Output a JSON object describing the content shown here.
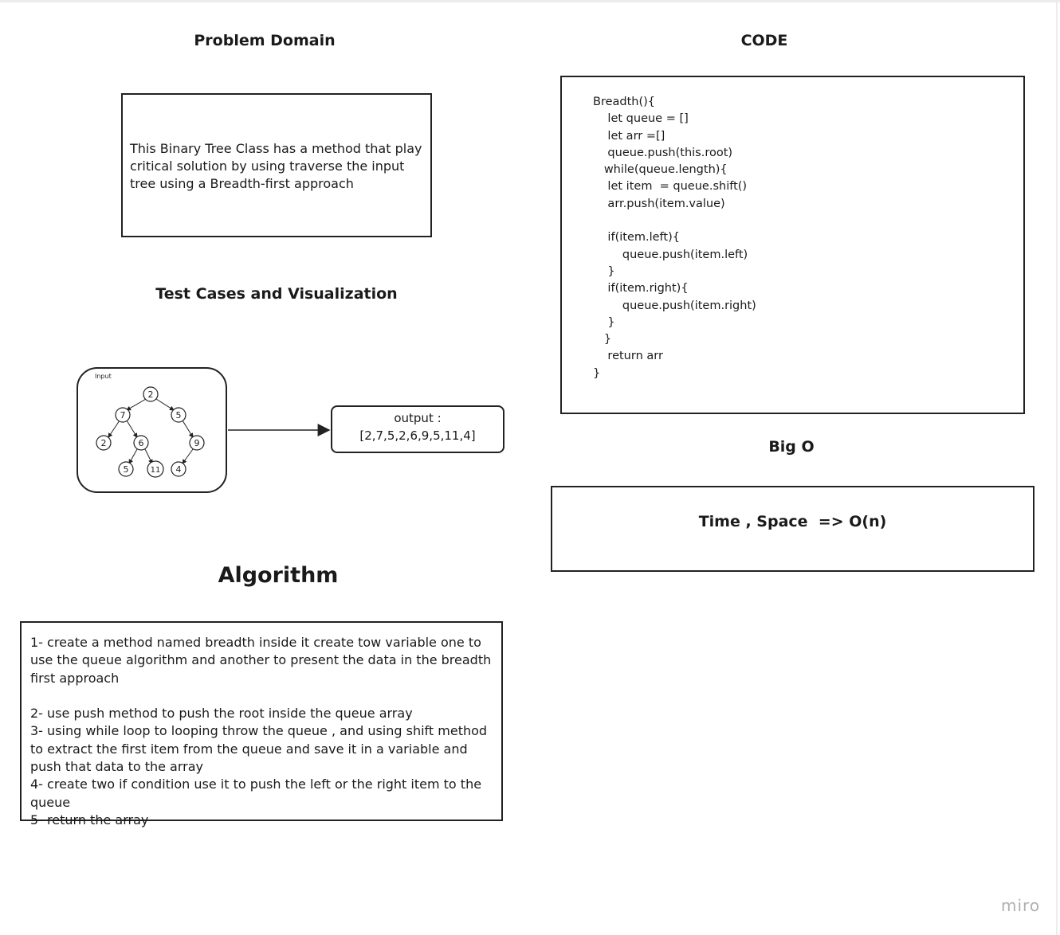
{
  "problem_domain": {
    "title": "Problem Domain",
    "text": "This Binary Tree Class has a method that play critical solution by using traverse the input tree using a Breadth-first approach"
  },
  "test_cases": {
    "title": "Test Cases and Visualization",
    "input_label": "Input",
    "tree_nodes": [
      "2",
      "7",
      "5",
      "2",
      "6",
      "9",
      "5",
      "11",
      "4"
    ],
    "output_label": "output :",
    "output_value": "[2,7,5,2,6,9,5,11,4]"
  },
  "algorithm": {
    "title": "Algorithm",
    "lines": [
      "1- create a method named breadth inside it create tow variable one to use the queue algorithm and another to present the data in the breadth first approach",
      "",
      "2- use push method to push the root inside the queue array",
      "3- using while loop to looping throw the queue , and using shift method  to extract the first item from the queue and save it in a variable and push that data to the array",
      "4- create two if condition use it to push the left or the right item to the queue",
      "5- return the array"
    ]
  },
  "code": {
    "title": "CODE",
    "lines": [
      "Breadth(){",
      "    let queue = []",
      "    let arr =[]",
      "    queue.push(this.root)",
      "   while(queue.length){",
      "    let item  = queue.shift()",
      "    arr.push(item.value)",
      "",
      "    if(item.left){",
      "        queue.push(item.left)",
      "    }",
      "    if(item.right){",
      "        queue.push(item.right)",
      "    }",
      "   }",
      "    return arr",
      "}"
    ]
  },
  "big_o": {
    "title": "Big O",
    "text": "Time , Space  => O(n)"
  },
  "watermark": "miro"
}
